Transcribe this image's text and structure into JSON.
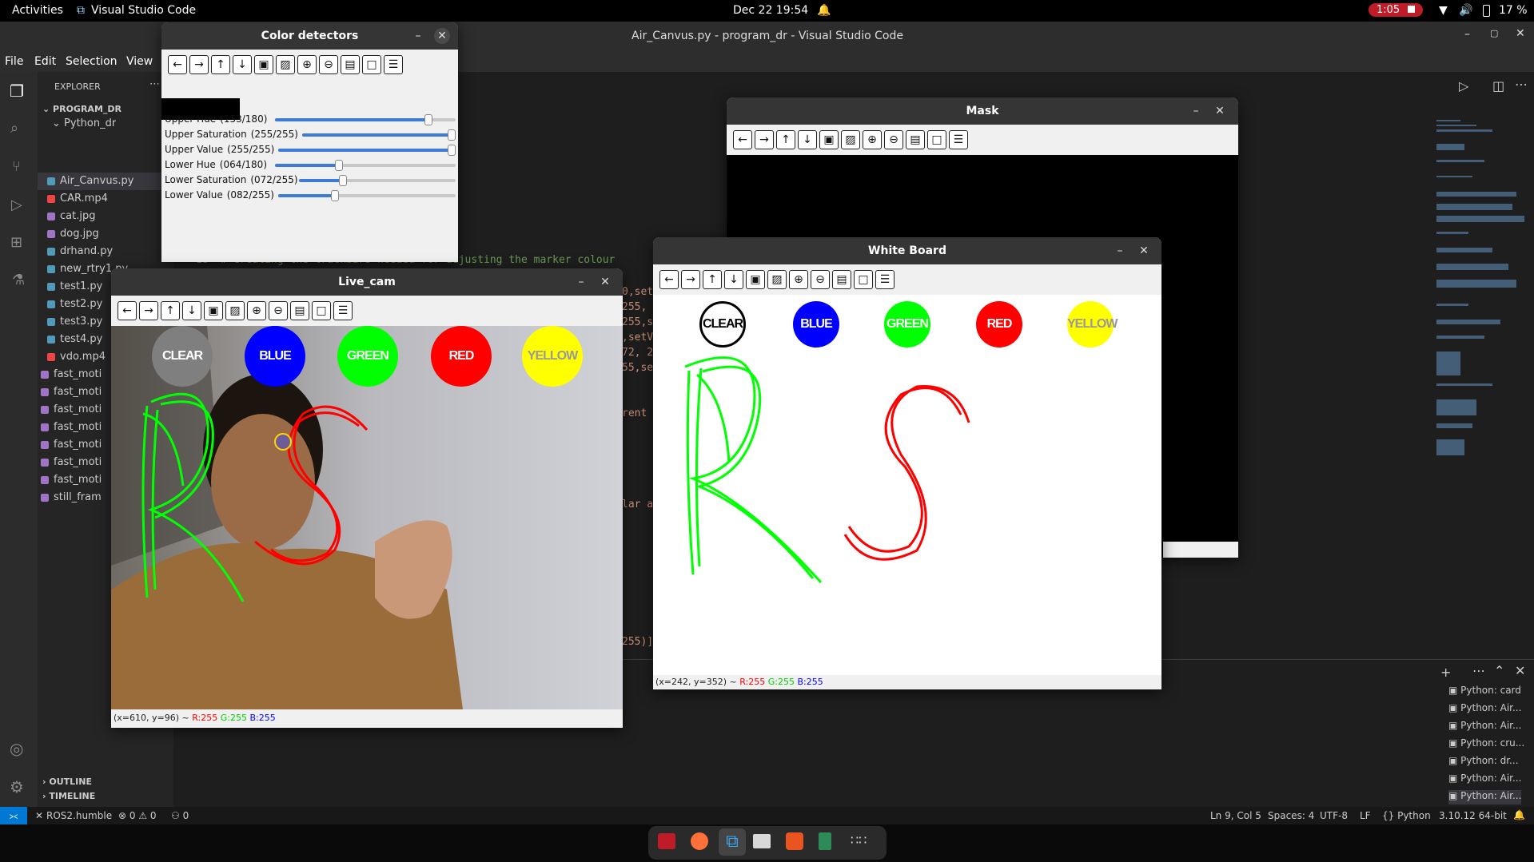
{
  "topbar": {
    "activities": "Activities",
    "app": "Visual Studio Code",
    "clock": "Dec 22  19:54",
    "record_time": "1:05",
    "battery": "17 %"
  },
  "vscode": {
    "title": "Air_Canvus.py - program_dr - Visual Studio Code",
    "menu": [
      "File",
      "Edit",
      "Selection",
      "View"
    ],
    "explorer_label": "EXPLORER",
    "project": "PROGRAM_DR",
    "folder": "Python_dr",
    "files": [
      "Air_Canvus.py",
      "CAR.mp4",
      "cat.jpg",
      "dog.jpg",
      "drhand.py",
      "new_rtry1.py",
      "test1.py",
      "test2.py",
      "test3.py",
      "test4.py",
      "vdo.mp4",
      "fast_moti",
      "fast_moti",
      "fast_moti",
      "fast_moti",
      "fast_moti",
      "fast_moti",
      "fast_moti",
      "still_fram"
    ],
    "outline": "OUTLINE",
    "timeline": "TIMELINE",
    "code_line": "18  # Creating the trackbars needed for adjusting the marker colour",
    "code_frags": [
      "0,set",
      "255,",
      "255,s",
      ",setV",
      "72, 2",
      "55,se",
      "rent",
      "lar a",
      "255)]"
    ],
    "terminals": [
      "Python: card",
      "Python: Air...",
      "Python: Air...",
      "Python: cru...",
      "Python: dr...",
      "Python: Air...",
      "Python: Air..."
    ],
    "status": {
      "remote": "ROS2.humble",
      "errors": "0",
      "warnings": "0",
      "ports": "0",
      "position": "Ln 9, Col 5",
      "spaces": "Spaces: 4",
      "encoding": "UTF-8",
      "eol": "LF",
      "language": "Python",
      "interpreter": "3.10.12 64-bit"
    }
  },
  "color_detectors": {
    "title": "Color detectors",
    "sliders": [
      {
        "label": "Upper Hue",
        "value_text": "(153/180)",
        "value": 153,
        "max": 180
      },
      {
        "label": "Upper Saturation",
        "value_text": "(255/255)",
        "value": 255,
        "max": 255
      },
      {
        "label": "Upper Value",
        "value_text": "(255/255)",
        "value": 255,
        "max": 255
      },
      {
        "label": "Lower Hue",
        "value_text": "(064/180)",
        "value": 64,
        "max": 180
      },
      {
        "label": "Lower Saturation",
        "value_text": "(072/255)",
        "value": 72,
        "max": 255
      },
      {
        "label": "Lower Value",
        "value_text": "(082/255)",
        "value": 82,
        "max": 255
      }
    ]
  },
  "mask": {
    "title": "Mask"
  },
  "live_cam": {
    "title": "Live_cam",
    "buttons": [
      "CLEAR",
      "BLUE",
      "GREEN",
      "RED",
      "YELLOW"
    ],
    "status_coords": "(x=610, y=96) ~",
    "r": "R:255",
    "g": "G:255",
    "b": "B:255"
  },
  "white_board": {
    "title": "White Board",
    "buttons": [
      "CLEAR",
      "BLUE",
      "GREEN",
      "RED",
      "YELLOW"
    ],
    "status_coords": "(x=242, y=352) ~",
    "r": "R:255",
    "g": "G:255",
    "b": "B:255"
  },
  "colors": {
    "clear": "#7f7f7f",
    "blue": "#0000ff",
    "green": "#00ff00",
    "red": "#ff0000",
    "yellow": "#ffff00"
  }
}
